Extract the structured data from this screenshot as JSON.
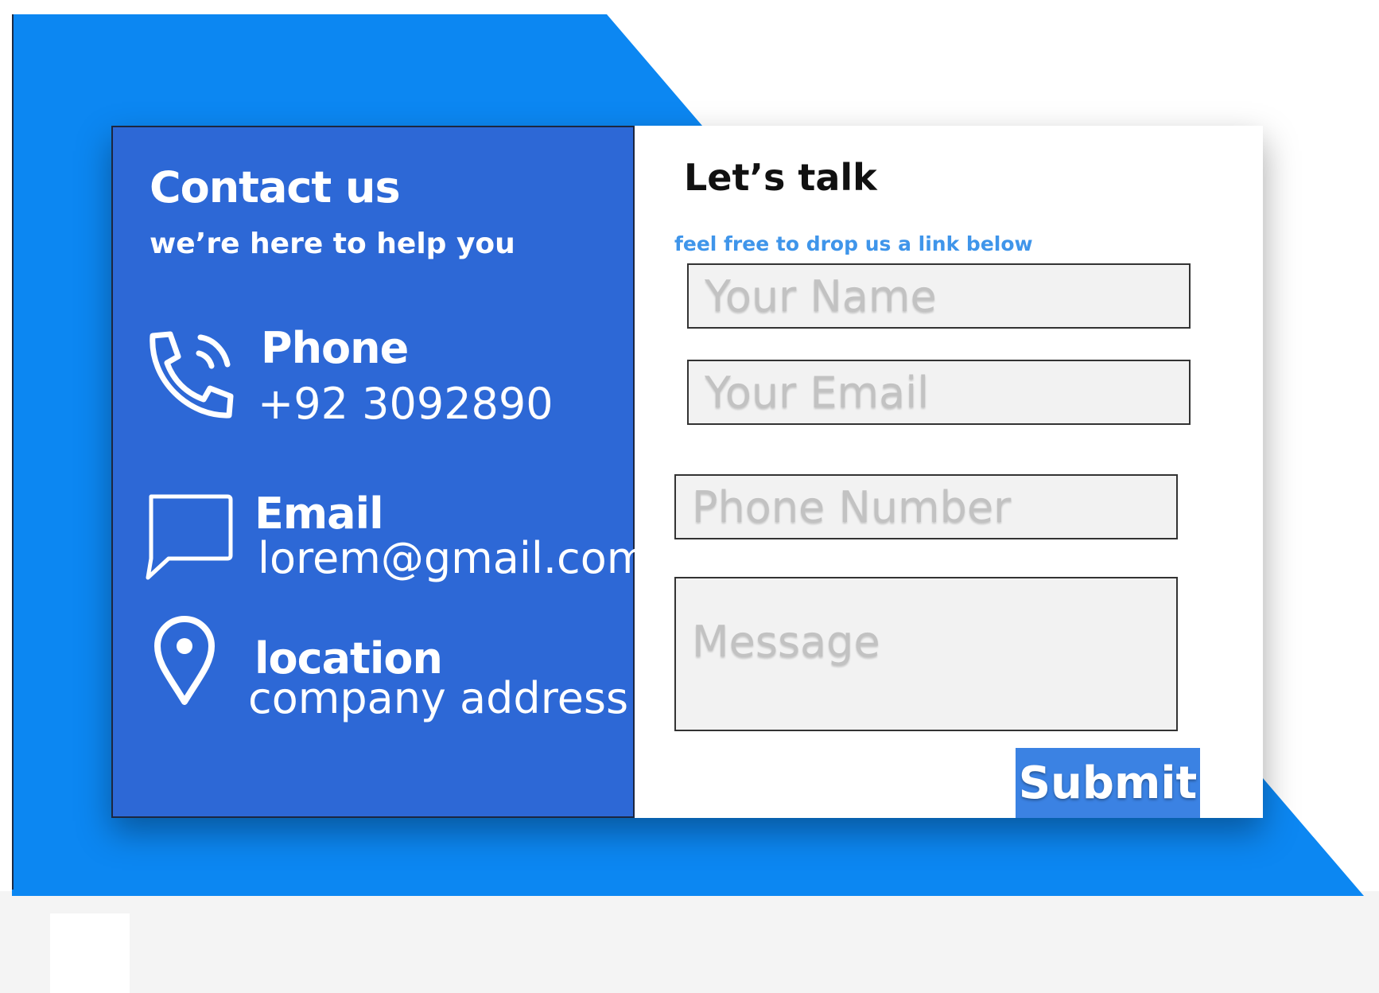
{
  "theme": {
    "background": "#0c87f2",
    "panel": "#2d68d6",
    "accent": "#3f95ea",
    "button": "#3b82e3"
  },
  "contact": {
    "title": "Contact us",
    "subtitle": "we’re here to help you",
    "phone": {
      "label": "Phone",
      "value": "+92 3092890",
      "icon": "phone-icon"
    },
    "email": {
      "label": "Email",
      "value": "lorem@gmail.com",
      "icon": "chat-bubble-icon"
    },
    "location": {
      "label": "location",
      "value": "company address",
      "icon": "location-pin-icon"
    }
  },
  "form": {
    "title": "Let’s talk",
    "subtitle": "feel free to  drop us a link below",
    "name_placeholder": "Your Name",
    "email_placeholder": "Your Email",
    "phone_placeholder": "Phone Number",
    "message_placeholder": "Message",
    "submit_label": "Submit"
  }
}
